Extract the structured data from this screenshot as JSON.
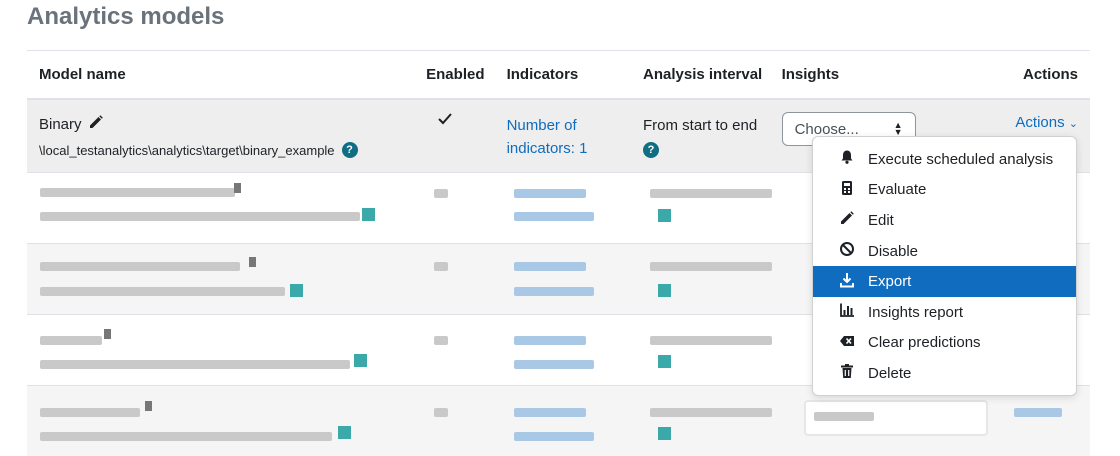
{
  "page": {
    "title": "Analytics models"
  },
  "table": {
    "headers": [
      "Model name",
      "Enabled",
      "Indicators",
      "Analysis interval",
      "Insights",
      "Actions"
    ],
    "first_row": {
      "name": "Binary",
      "target": "\\local_testanalytics\\analytics\\target\\binary_example",
      "indicators_line1": "Number of",
      "indicators_line2": "indicators: 1",
      "interval": "From start to end",
      "insights_select": "Choose...",
      "actions_label": "Actions"
    }
  },
  "dropdown": {
    "items": [
      {
        "label": "Execute scheduled analysis",
        "icon": "bell-icon"
      },
      {
        "label": "Evaluate",
        "icon": "calculator-icon"
      },
      {
        "label": "Edit",
        "icon": "pencil-icon"
      },
      {
        "label": "Disable",
        "icon": "ban-icon"
      },
      {
        "label": "Export",
        "icon": "download-icon",
        "active": true
      },
      {
        "label": "Insights report",
        "icon": "bar-chart-icon"
      },
      {
        "label": "Clear predictions",
        "icon": "backspace-icon"
      },
      {
        "label": "Delete",
        "icon": "trash-icon"
      }
    ]
  },
  "colors": {
    "link": "#0f6cbf",
    "active_bg": "#0f6cbf",
    "help_icon": "#0f6e84"
  }
}
